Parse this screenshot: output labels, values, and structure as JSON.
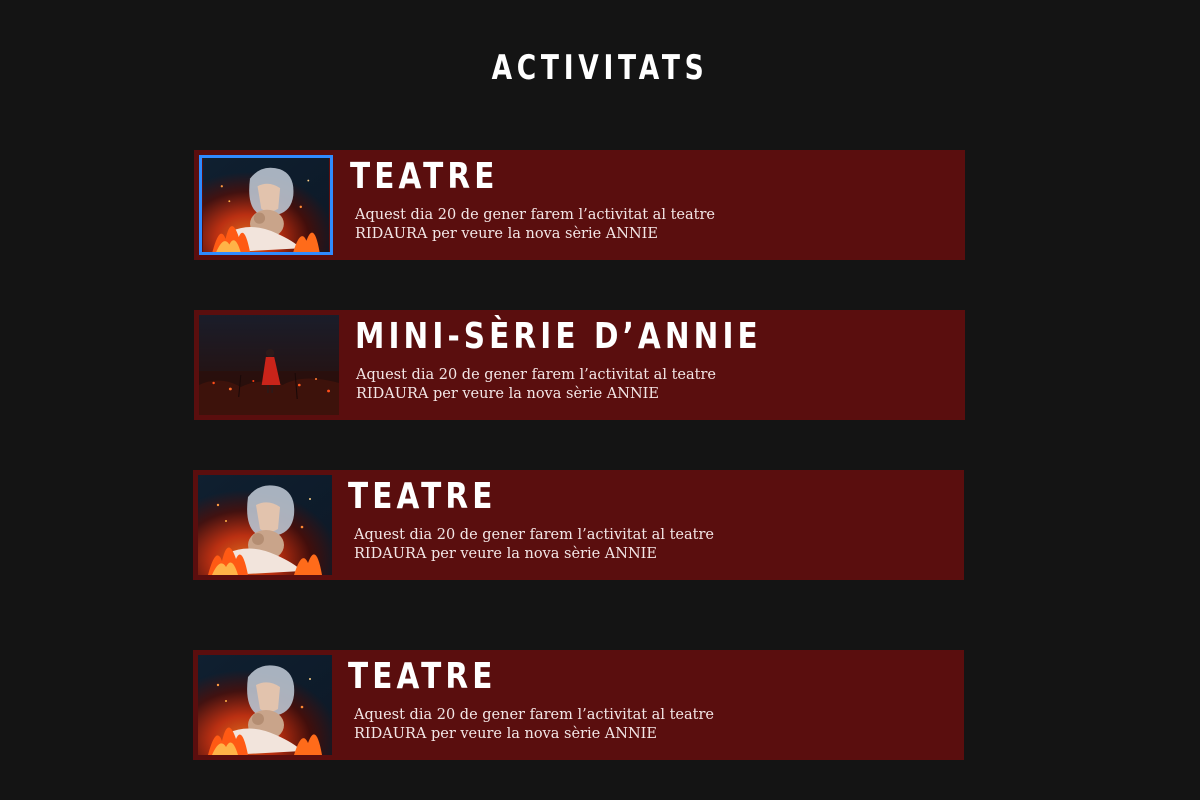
{
  "page": {
    "title": "ACTIVITATS",
    "background": "#141414",
    "card_color": "#5a0e0e",
    "selection_color": "#2f8bff"
  },
  "activities": [
    {
      "title": "TEATRE",
      "description": "Aquest dia 20 de gener farem l’activitat al teatre RIDAURA per veure la nova sèrie ANNIE",
      "image": "girl-with-teddy-bear-in-flames",
      "selected": true
    },
    {
      "title": "MINI-SÈRIE D’ANNIE",
      "description": "Aquest dia 20 de gener farem l’activitat al teatre RIDAURA per veure la nova sèrie ANNIE",
      "image": "girl-in-red-dress-in-dark-field",
      "selected": false
    },
    {
      "title": "TEATRE",
      "description": "Aquest dia 20 de gener farem l’activitat al teatre RIDAURA per veure la nova sèrie ANNIE",
      "image": "girl-with-teddy-bear-in-flames",
      "selected": false
    },
    {
      "title": "TEATRE",
      "description": "Aquest dia 20 de gener farem l’activitat al teatre RIDAURA per veure la nova sèrie ANNIE",
      "image": "girl-with-teddy-bear-in-flames",
      "selected": false
    }
  ]
}
